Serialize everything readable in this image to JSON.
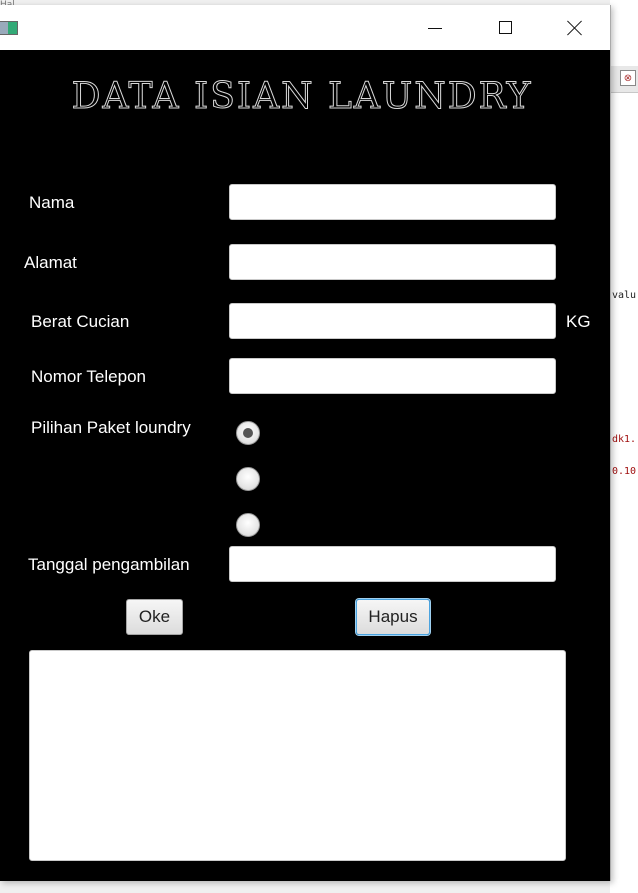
{
  "background": {
    "top_text": "Hal",
    "code_lines": [
      "valu",
      "dk1.",
      "0.10"
    ]
  },
  "window": {
    "title": "",
    "icons": {
      "app": "app-icon",
      "minimize": "minimize-icon",
      "maximize": "maximize-icon",
      "close": "close-icon"
    }
  },
  "form": {
    "title": "DATA ISIAN LAUNDRY",
    "labels": {
      "nama": "Nama",
      "alamat": "Alamat",
      "berat": "Berat Cucian",
      "kg": "KG",
      "telepon": "Nomor Telepon",
      "paket": "Pilihan Paket loundry",
      "tanggal": "Tanggal pengambilan"
    },
    "fields": {
      "nama": "",
      "alamat": "",
      "berat": "",
      "telepon": "",
      "tanggal": ""
    },
    "radio_options": [
      {
        "selected": true
      },
      {
        "selected": false
      },
      {
        "selected": false
      }
    ],
    "buttons": {
      "oke": "Oke",
      "hapus": "Hapus"
    },
    "output": ""
  },
  "colors": {
    "window_bg": "#000000",
    "label": "#ffffff",
    "focus": "#4aa3df"
  }
}
